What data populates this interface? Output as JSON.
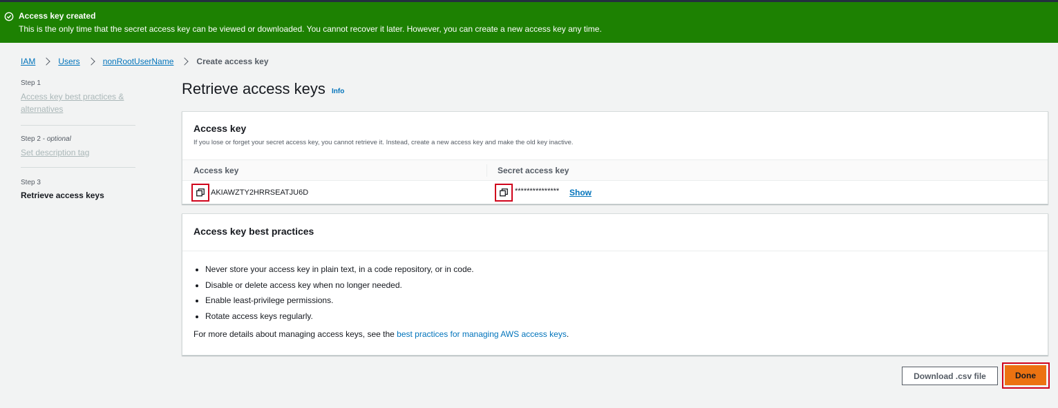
{
  "flash": {
    "title": "Access key created",
    "message": "This is the only time that the secret access key can be viewed or downloaded. You cannot recover it later. However, you can create a new access key any time."
  },
  "breadcrumb": {
    "items": [
      "IAM",
      "Users",
      "nonRootUserName"
    ],
    "current": "Create access key"
  },
  "steps": [
    {
      "label": "Step 1",
      "title": "Access key best practices & alternatives"
    },
    {
      "label": "Step 2",
      "label_suffix": "optional",
      "title": "Set description tag"
    },
    {
      "label": "Step 3",
      "title": "Retrieve access keys"
    }
  ],
  "page": {
    "title": "Retrieve access keys",
    "info": "Info"
  },
  "access_key_panel": {
    "title": "Access key",
    "description": "If you lose or forget your secret access key, you cannot retrieve it. Instead, create a new access key and make the old key inactive.",
    "col_access_key": "Access key",
    "col_secret_key": "Secret access key",
    "access_key_value": "AKIAWZTY2HRRSEATJU6D",
    "secret_masked": "***************",
    "show_label": "Show"
  },
  "best_practices": {
    "title": "Access key best practices",
    "items": [
      "Never store your access key in plain text, in a code repository, or in code.",
      "Disable or delete access key when no longer needed.",
      "Enable least-privilege permissions.",
      "Rotate access keys regularly."
    ],
    "more_prefix": "For more details about managing access keys, see the ",
    "more_link": "best practices for managing AWS access keys",
    "more_suffix": "."
  },
  "actions": {
    "download_csv": "Download .csv file",
    "done": "Done"
  },
  "colors": {
    "success": "#1d8102",
    "link": "#0073bb",
    "primary": "#ec7211",
    "highlight": "#d0021b"
  }
}
